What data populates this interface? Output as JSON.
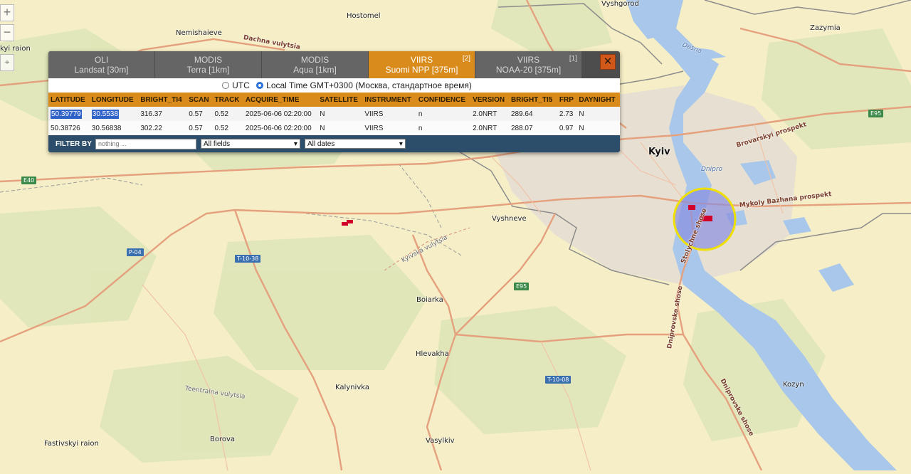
{
  "map": {
    "places": [
      {
        "name": "Hostomel",
        "cls": ""
      },
      {
        "name": "Vyshgorod",
        "cls": ""
      },
      {
        "name": "Zazymia",
        "cls": ""
      },
      {
        "name": "Nemishaieve",
        "cls": ""
      },
      {
        "name": "kyi raion",
        "cls": ""
      },
      {
        "name": "Kyiv",
        "cls": "city"
      },
      {
        "name": "Dnipro",
        "cls": "river"
      },
      {
        "name": "Desna",
        "cls": "river"
      },
      {
        "name": "Vyshneve",
        "cls": ""
      },
      {
        "name": "Boiarka",
        "cls": ""
      },
      {
        "name": "Hlevakha",
        "cls": ""
      },
      {
        "name": "Kalynivka",
        "cls": ""
      },
      {
        "name": "Kozyn",
        "cls": ""
      },
      {
        "name": "Fastivskyi raion",
        "cls": ""
      },
      {
        "name": "Borova",
        "cls": ""
      },
      {
        "name": "Vasylkiv",
        "cls": ""
      }
    ],
    "road_labels": [
      "Dachna vulytsia",
      "Brovarskyi prospekt",
      "Mykoly Bazhana prospekt",
      "Kyivska vulytsia",
      "Stolychne shose",
      "Dniprovske shose",
      "Dniprovske shose",
      "Teentralna vulytsia"
    ],
    "shields": [
      {
        "label": "E95",
        "color": "#3b8a4a"
      },
      {
        "label": "E40",
        "color": "#3b8a4a"
      },
      {
        "label": "P-04",
        "color": "#3a6fb0"
      },
      {
        "label": "T-10-38",
        "color": "#3a6fb0"
      },
      {
        "label": "E95",
        "color": "#3b8a4a"
      },
      {
        "label": "T-10-08",
        "color": "#3a6fb0"
      }
    ],
    "zoom_in": "+",
    "zoom_out": "−"
  },
  "panel": {
    "tabs": [
      {
        "line1": "OLI",
        "line2": "Landsat [30m]",
        "count": "",
        "active": false
      },
      {
        "line1": "MODIS",
        "line2": "Terra [1km]",
        "count": "",
        "active": false
      },
      {
        "line1": "MODIS",
        "line2": "Aqua [1km]",
        "count": "",
        "active": false
      },
      {
        "line1": "VIIRS",
        "line2": "Suomi NPP [375m]",
        "count": "[2]",
        "active": true
      },
      {
        "line1": "VIIRS",
        "line2": "NOAA-20 [375m]",
        "count": "[1]",
        "active": false
      }
    ],
    "close_label": "✕",
    "time": {
      "utc_label": "UTC",
      "local_label": "Local Time GMT+0300 (Москва, стандартное время)",
      "selected": "local"
    },
    "columns": [
      "LATITUDE",
      "LONGITUDE",
      "BRIGHT_TI4",
      "SCAN",
      "TRACK",
      "ACQUIRE_TIME",
      "SATELLITE",
      "INSTRUMENT",
      "CONFIDENCE",
      "VERSION",
      "BRIGHT_TI5",
      "FRP",
      "DAYNIGHT"
    ],
    "rows": [
      [
        "50.39779",
        "30.5538",
        "316.37",
        "0.57",
        "0.52",
        "2025-06-06 02:20:00",
        "N",
        "VIIRS",
        "n",
        "2.0NRT",
        "289.64",
        "2.73",
        "N"
      ],
      [
        "50.38726",
        "30.56838",
        "302.22",
        "0.57",
        "0.52",
        "2025-06-06 02:20:00",
        "N",
        "VIIRS",
        "n",
        "2.0NRT",
        "288.07",
        "0.97",
        "N"
      ]
    ],
    "filter": {
      "label": "FILTER BY",
      "placeholder": "nothing ...",
      "field_select": "All fields",
      "date_select": "All dates"
    }
  }
}
